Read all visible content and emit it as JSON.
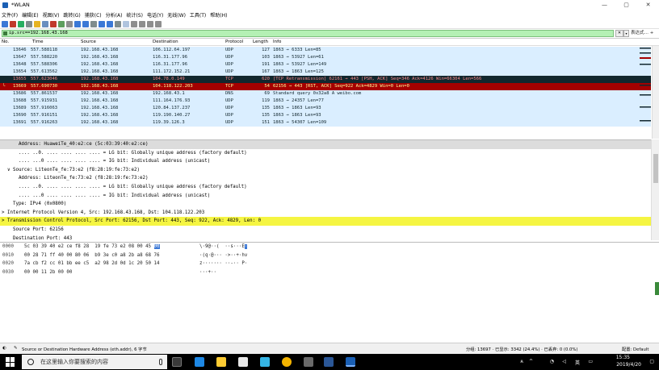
{
  "window": {
    "title": "*WLAN",
    "controls": [
      "—",
      "▢",
      "✕"
    ]
  },
  "menu": [
    "文件(F)",
    "编辑(E)",
    "视图(V)",
    "跳转(G)",
    "捕获(C)",
    "分析(A)",
    "统计(S)",
    "电话(Y)",
    "无线(W)",
    "工具(T)",
    "帮助(H)"
  ],
  "filter": {
    "value": "ip.src==192.168.43.168",
    "clear": "✕",
    "dropdown": "▾",
    "expression_label": "表达式…",
    "plus": "+"
  },
  "packet_list": {
    "columns": [
      "No.",
      "Time",
      "Source",
      "Destination",
      "Protocol",
      "Length",
      "Info"
    ],
    "rows": [
      {
        "no": "13646",
        "time": "557.588118",
        "src": "192.168.43.168",
        "dst": "106.112.64.197",
        "proto": "UDP",
        "len": "127",
        "info": "1863 → 6333 Len=85",
        "style": "udp"
      },
      {
        "no": "13647",
        "time": "557.588220",
        "src": "192.168.43.168",
        "dst": "116.31.177.96",
        "proto": "UDP",
        "len": "103",
        "info": "1863 → 53927 Len=61",
        "style": "udp"
      },
      {
        "no": "13648",
        "time": "557.588306",
        "src": "192.168.43.168",
        "dst": "116.31.177.96",
        "proto": "UDP",
        "len": "191",
        "info": "1863 → 53927 Len=149",
        "style": "udp"
      },
      {
        "no": "13654",
        "time": "557.613562",
        "src": "192.168.43.168",
        "dst": "111.172.152.21",
        "proto": "UDP",
        "len": "167",
        "info": "1863 → 1863 Len=125",
        "style": "udp"
      },
      {
        "no": "13655",
        "time": "557.623046",
        "src": "192.168.43.168",
        "dst": "104.78.0.149",
        "proto": "TCP",
        "len": "620",
        "info": "[TCP Retransmission] 62161 → 443 [PSH, ACK] Seq=346 Ack=4126 Win=66304 Len=566",
        "style": "retrans"
      },
      {
        "no": "13669",
        "time": "557.690730",
        "src": "192.168.43.168",
        "dst": "104.118.122.203",
        "proto": "TCP",
        "len": "54",
        "info": "62156 → 443 [RST, ACK] Seq=922 Ack=4829 Win=0 Len=0",
        "style": "selected"
      },
      {
        "no": "13686",
        "time": "557.861537",
        "src": "192.168.43.168",
        "dst": "192.168.43.1",
        "proto": "DNS",
        "len": "69",
        "info": "Standard query 0x32a8 A weibo.com",
        "style": "udp"
      },
      {
        "no": "13688",
        "time": "557.915931",
        "src": "192.168.43.168",
        "dst": "111.164.176.93",
        "proto": "UDP",
        "len": "119",
        "info": "1863 → 24357 Len=77",
        "style": "udp"
      },
      {
        "no": "13689",
        "time": "557.916063",
        "src": "192.168.43.168",
        "dst": "120.84.137.237",
        "proto": "UDP",
        "len": "135",
        "info": "1863 → 1863 Len=93",
        "style": "udp"
      },
      {
        "no": "13690",
        "time": "557.916151",
        "src": "192.168.43.168",
        "dst": "119.190.140.27",
        "proto": "UDP",
        "len": "135",
        "info": "1863 → 1863 Len=93",
        "style": "udp"
      },
      {
        "no": "13691",
        "time": "557.916263",
        "src": "192.168.43.168",
        "dst": "119.39.126.3",
        "proto": "UDP",
        "len": "151",
        "info": "1863 → 54307 Len=109",
        "style": "udp"
      }
    ]
  },
  "details": [
    {
      "text": "      Address: HuaweiTe_40:e2:ce (5c:03:39:40:e2:ce)",
      "style": "sel"
    },
    {
      "text": "      .... ..0. .... .... .... .... = LG bit: Globally unique address (factory default)",
      "style": ""
    },
    {
      "text": "      .... ...0 .... .... .... .... = IG bit: Individual address (unicast)",
      "style": ""
    },
    {
      "text": "  ∨ Source: LiteonTe_fe:73:e2 (f8:28:19:fe:73:e2)",
      "style": ""
    },
    {
      "text": "      Address: LiteonTe_fe:73:e2 (f8:28:19:fe:73:e2)",
      "style": ""
    },
    {
      "text": "      .... ..0. .... .... .... .... = LG bit: Globally unique address (factory default)",
      "style": ""
    },
    {
      "text": "      .... ...0 .... .... .... .... = IG bit: Individual address (unicast)",
      "style": ""
    },
    {
      "text": "    Type: IPv4 (0x0800)",
      "style": ""
    },
    {
      "text": "> Internet Protocol Version 4, Src: 192.168.43.168, Dst: 104.118.122.203",
      "style": ""
    },
    {
      "text": "> Transmission Control Protocol, Src Port: 62156, Dst Port: 443, Seq: 922, Ack: 4829, Len: 0",
      "style": "hl"
    },
    {
      "text": "    Source Port: 62156",
      "style": ""
    },
    {
      "text": "    Destination Port: 443",
      "style": ""
    }
  ],
  "hex": [
    {
      "off": "0000",
      "bytes_pre": "5c 03 39 40 e2 ce f8 28  19 fe 73 e2 08 00 45 ",
      "bytes_sel": "00",
      "ascii_pre": "\\·9@··(  ··s···E",
      "ascii_sel": "·"
    },
    {
      "off": "0010",
      "bytes_pre": "00 28 71 ff 40 00 80 06  b9 3e c0 a8 2b a8 68 76",
      "bytes_sel": "",
      "ascii_pre": "·(q·@··· ·>··+·hv",
      "ascii_sel": ""
    },
    {
      "off": "0020",
      "bytes_pre": "7a cb f2 cc 01 bb ee c5  a2 98 2d 0d 1c 20 50 14",
      "bytes_sel": "",
      "ascii_pre": "z······· ··-·· P·",
      "ascii_sel": ""
    },
    {
      "off": "0030",
      "bytes_pre": "00 00 11 2b 00 00",
      "bytes_sel": "",
      "ascii_pre": "···+··",
      "ascii_sel": ""
    }
  ],
  "status": {
    "left": "Source or Destination Hardware Address (eth.addr), 6 字节",
    "groups": "分组: 13697 · 已显示: 3342 (24.4%) · 已丢弃: 0 (0.0%)",
    "profile": "配置: Default"
  },
  "taskbar": {
    "search_placeholder": "在这里输入你要搜索的内容",
    "time": "15:35",
    "date": "2019/4/20",
    "ime": "英"
  },
  "colors": {
    "udp_row": "#daeeff",
    "retrans_row": "#12272e",
    "retrans_text": "#f78787",
    "selected_row": "#a40000",
    "selected_text": "#fffc9c",
    "filter_ok": "#b4f0b4",
    "highlight": "#f5f542"
  }
}
